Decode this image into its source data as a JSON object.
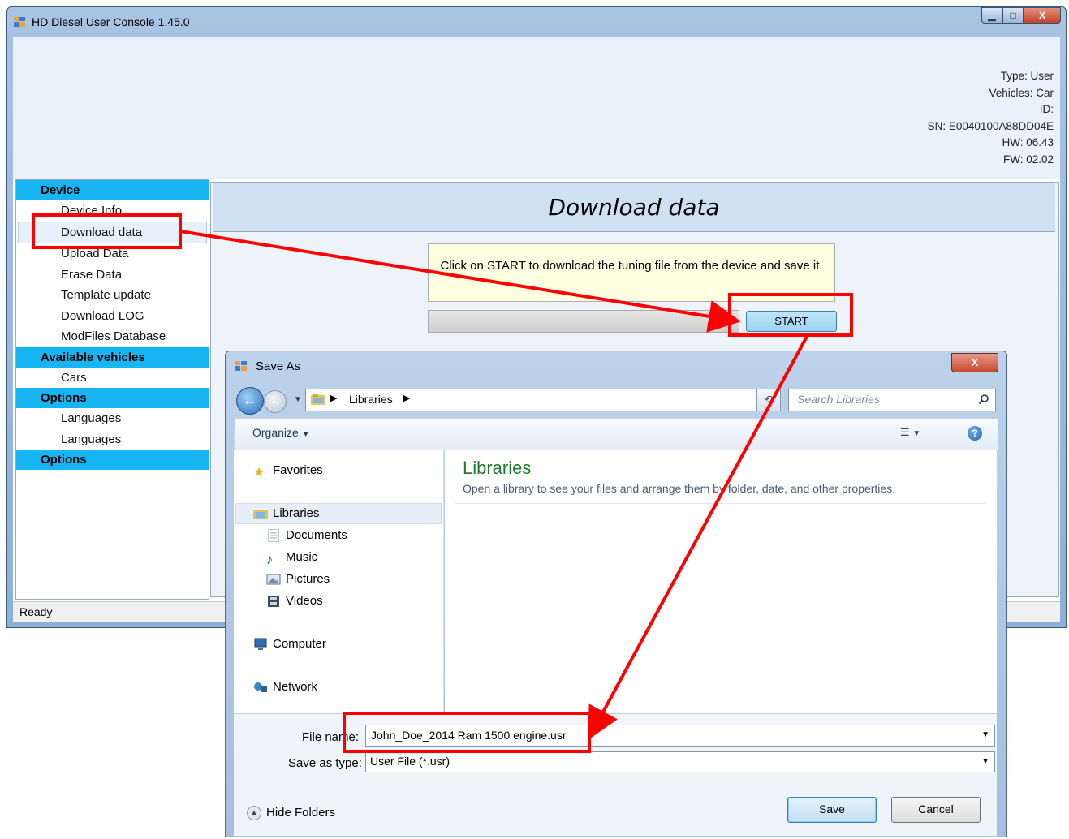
{
  "main_window": {
    "title": "HD Diesel User Console 1.45.0",
    "device_info": {
      "type": "Type: User",
      "vehicles": "Vehicles: Car",
      "id": "ID:",
      "sn": "SN: E0040100A88DD04E",
      "hw": "HW: 06.43",
      "fw": "FW: 02.02"
    },
    "sidebar": {
      "sections": [
        {
          "header": "Device",
          "items": [
            "Device Info",
            "Download data",
            "Upload Data",
            "Erase Data",
            "Template update",
            "Download LOG",
            "ModFiles Database"
          ]
        },
        {
          "header": "Available vehicles",
          "items": [
            "Cars"
          ]
        },
        {
          "header": "Options",
          "items": [
            "Languages",
            "Languages"
          ]
        },
        {
          "header": "Options",
          "items": []
        }
      ],
      "active_item": "Download data"
    },
    "content": {
      "title": "Download data",
      "hint": "Click on START to download the tuning file from the device and save it.",
      "start_label": "START",
      "progress": 0
    },
    "status": "Ready"
  },
  "save_dialog": {
    "title": "Save As",
    "address": {
      "location": "Libraries"
    },
    "search_placeholder": "Search Libraries",
    "toolbar": {
      "organize": "Organize"
    },
    "nav": {
      "favorites": "Favorites",
      "libraries": "Libraries",
      "documents": "Documents",
      "music": "Music",
      "pictures": "Pictures",
      "videos": "Videos",
      "computer": "Computer",
      "network": "Network"
    },
    "main": {
      "heading": "Libraries",
      "description": "Open a library to see your files and arrange them by folder, date, and other properties."
    },
    "file_name_label": "File name:",
    "file_name_value": "John_Doe_2014 Ram 1500 engine.usr",
    "save_type_label": "Save as type:",
    "save_type_value": "User File  (*.usr)",
    "hide_folders": "Hide Folders",
    "save_label": "Save",
    "cancel_label": "Cancel"
  },
  "colors": {
    "sidebar_header": "#17b6f2",
    "annotation": "#ff0000",
    "library_heading": "#1e7a2c"
  }
}
